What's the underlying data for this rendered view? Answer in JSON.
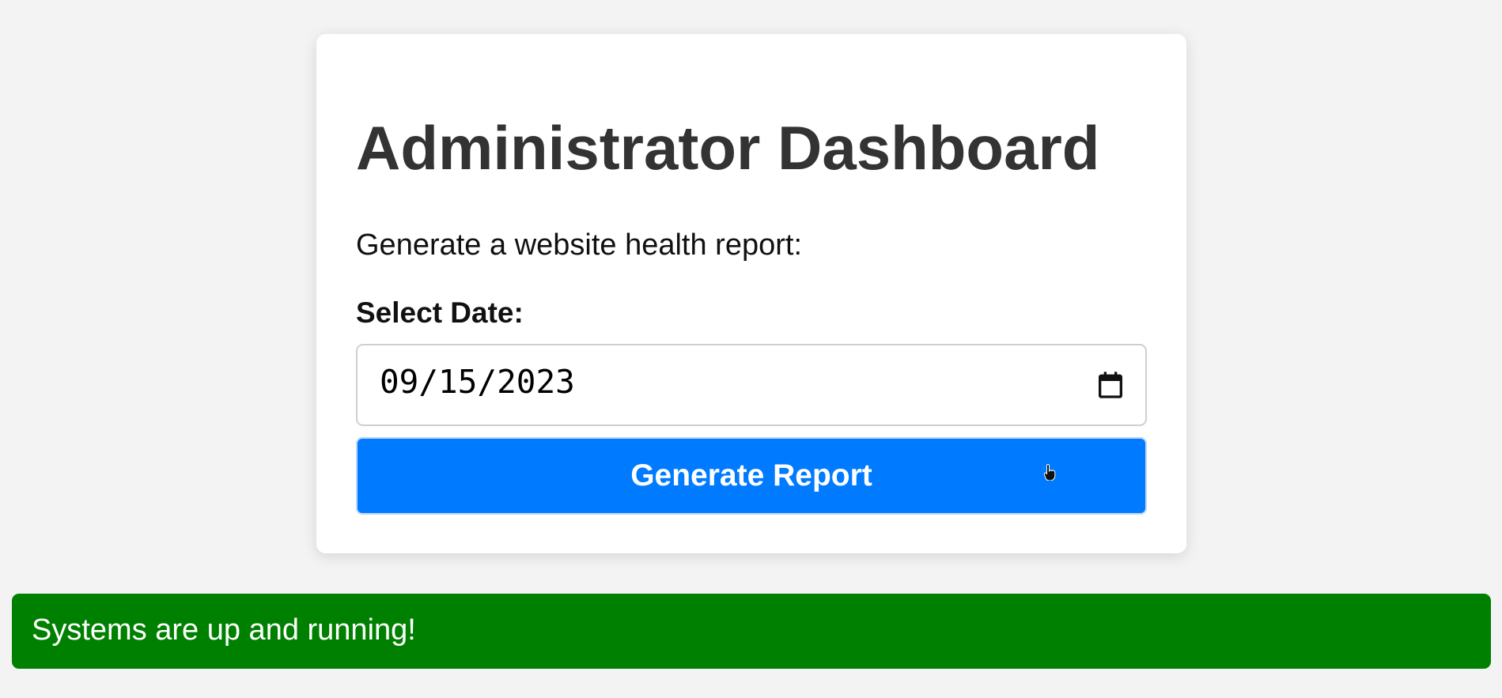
{
  "dashboard": {
    "title": "Administrator Dashboard",
    "subtitle": "Generate a website health report:",
    "date_label": "Select Date:",
    "date_value": "09/15/2023",
    "button_label": "Generate Report",
    "button_color": "#007bff"
  },
  "status": {
    "message": "Systems are up and running!",
    "color": "#008000"
  },
  "icons": {
    "calendar": "calendar-icon",
    "cursor": "hand-pointer-cursor-icon"
  }
}
